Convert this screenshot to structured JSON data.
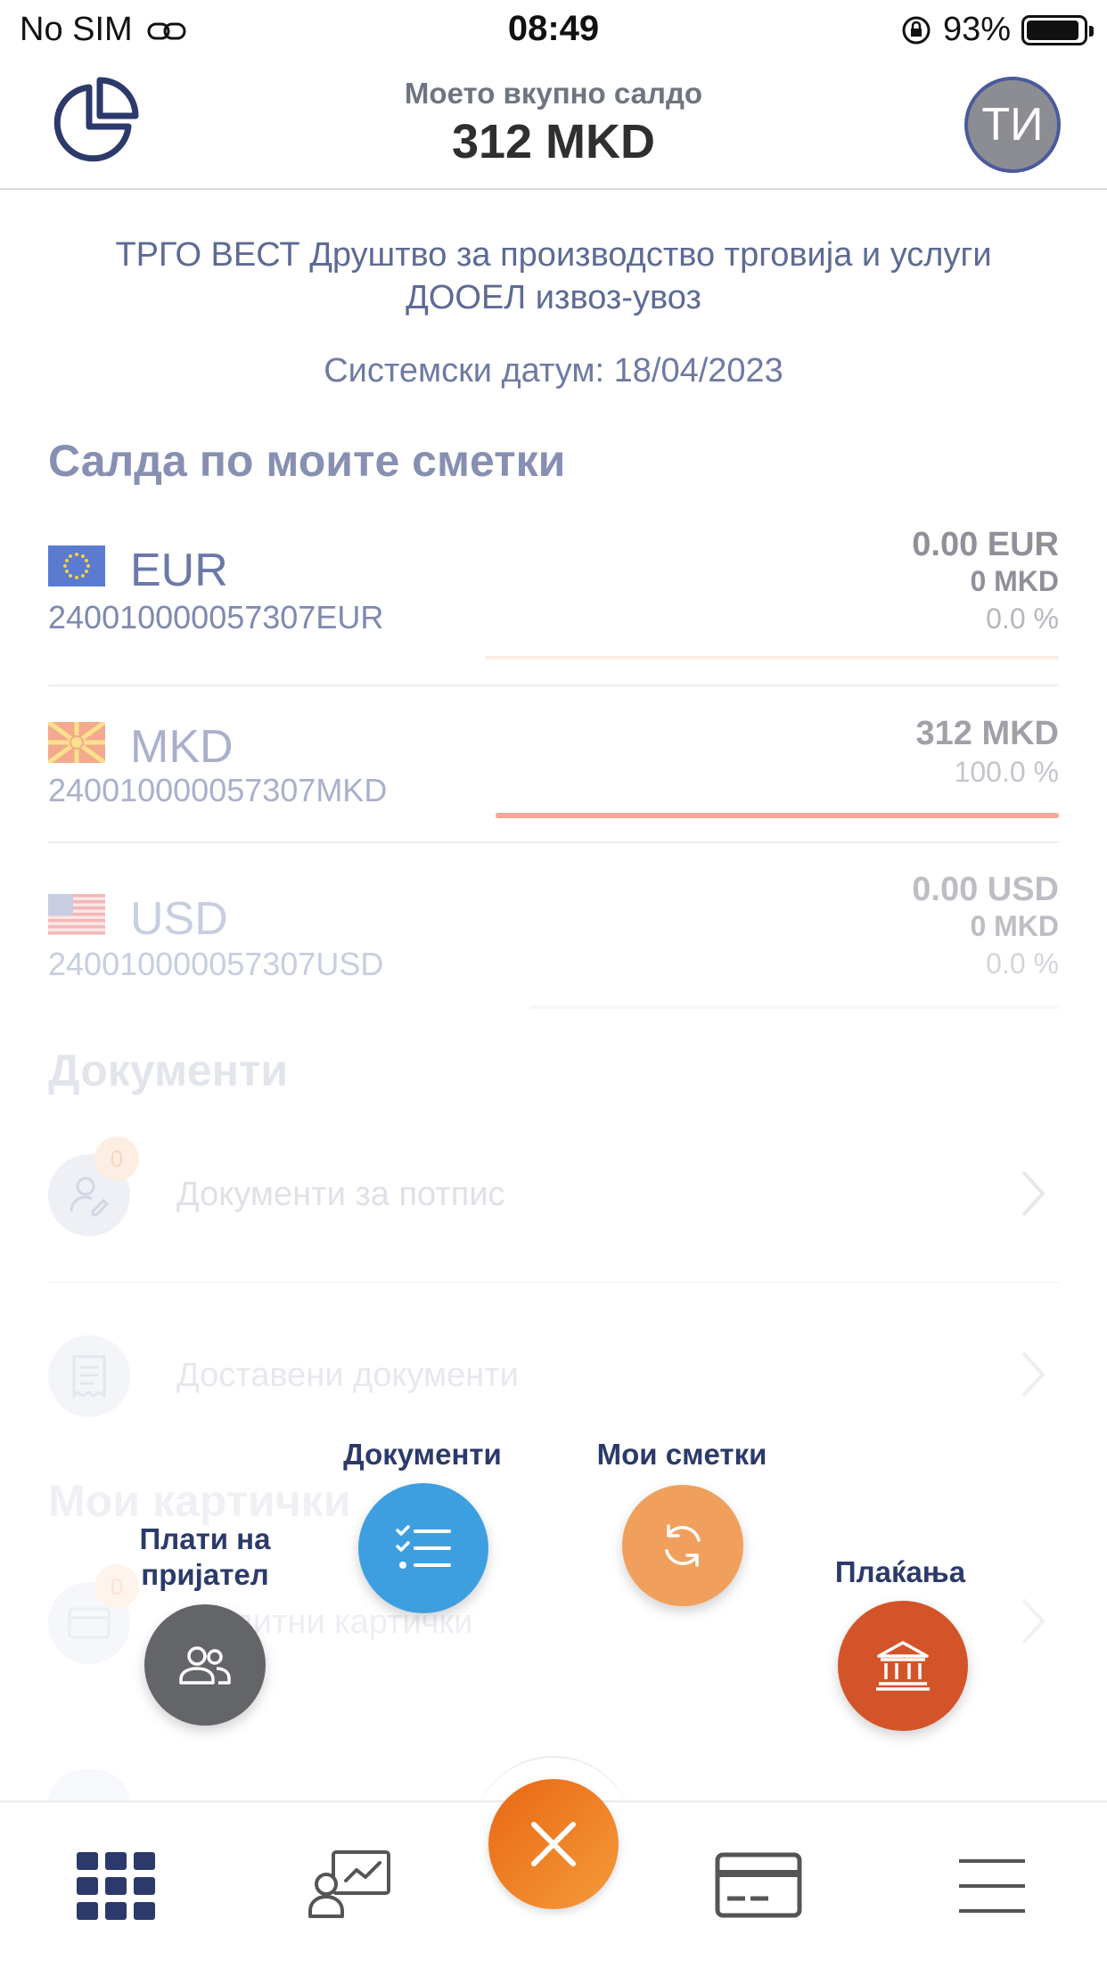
{
  "status_bar": {
    "carrier": "No SIM",
    "time": "08:49",
    "battery": "93%",
    "battery_level": 0.93
  },
  "header": {
    "subtitle": "Моето вкупно салдо",
    "total": "312 MKD",
    "avatar_initials": "ТИ"
  },
  "company": "ТРГО ВЕСТ Друштво за производство  трговија и услуги ДООЕЛ извоз-увоз",
  "system_date": "Системски датум: 18/04/2023",
  "accounts_section": {
    "title": "Салда по моите сметки",
    "accounts": [
      {
        "currency": "EUR",
        "number": "240010000057307EUR",
        "amount": "0.00 EUR",
        "amount_mkd": "0 MKD",
        "percent": "0.0 %",
        "share": 0.0
      },
      {
        "currency": "MKD",
        "number": "240010000057307MKD",
        "amount": "312 MKD",
        "percent": "100.0 %",
        "share": 1.0
      },
      {
        "currency": "USD",
        "number": "240010000057307USD",
        "amount": "0.00 USD",
        "amount_mkd": "0 MKD",
        "percent": "0.0 %",
        "share": 0.0
      }
    ]
  },
  "documents_section": {
    "title": "Документи",
    "items": [
      {
        "label": "Документи за потпис",
        "badge": "0"
      },
      {
        "label": "Доставени документи"
      }
    ]
  },
  "cards_section": {
    "title": "Мои картички",
    "items": [
      {
        "label": "Кредитни картички",
        "badge": "0"
      }
    ]
  },
  "fab_menu": {
    "pay_friend": "Плати на\nпријател",
    "documents": "Документи",
    "my_accounts": "Мои сметки",
    "payments": "Плаќања"
  },
  "colors": {
    "accent_orange": "#f08a2c",
    "documents_blue": "#3e9fe0",
    "accounts_orange": "#f0a05c",
    "payments_red": "#d4542a",
    "pay_friend_gray": "#646568",
    "navy": "#2c3a6b"
  },
  "tabbar": {
    "icons": [
      "dashboard-grid-icon",
      "presentation-icon",
      "close-icon",
      "card-icon",
      "menu-icon"
    ]
  }
}
